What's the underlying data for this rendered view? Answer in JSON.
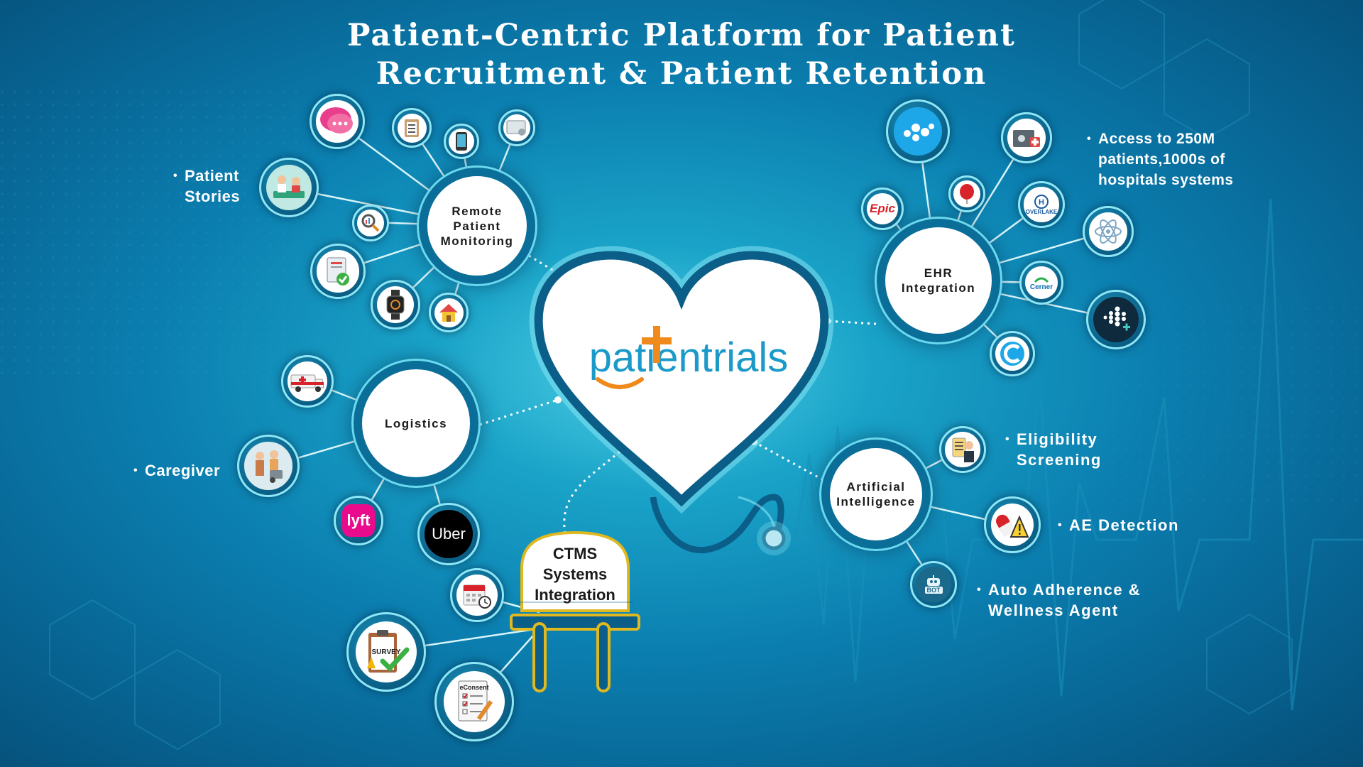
{
  "title": {
    "line1": "Patient-Centric Platform for Patient",
    "line2": "Recruitment & Patient Retention"
  },
  "center": {
    "logo_text": "patientrials",
    "logo_plus_color": "#f08a1c",
    "logo_color": "#1b9ac9"
  },
  "hubs": {
    "rpm": "Remote\nPatient\nMonitoring",
    "ehr": "EHR\nIntegration",
    "logistics": "Logistics",
    "ai": "Artificial\nIntelligence",
    "ctms": "CTMS\nSystems\nIntegration"
  },
  "bullets": {
    "patient_stories": "Patient\nStories",
    "access": "Access to 250M\npatients,1000s of\nhospitals systems",
    "caregiver": "Caregiver",
    "eligibility": "Eligibility\nScreening",
    "ae": "AE Detection",
    "adherence": "Auto Adherence &\nWellness Agent"
  },
  "logos": {
    "epic": "Epic",
    "overlake": "OVERLAKE",
    "cerner": "Cerner",
    "lyft": "lyft",
    "uber": "Uber",
    "survey": "SURVEY",
    "econsent": "eConsent",
    "bot": "BOT"
  },
  "icons": {
    "rpm_nodes": [
      "chat-bubbles-icon",
      "clipboard-checklist-icon",
      "smartphone-icon",
      "tablet-icon",
      "patient-stories-icon",
      "magnifier-chart-icon",
      "document-check-icon",
      "smartwatch-icon",
      "home-icon"
    ],
    "ehr_nodes": [
      "dots-logo-icon",
      "medical-folder-icon",
      "epic-logo-icon",
      "balloon-icon",
      "overlake-logo-icon",
      "atom-icon",
      "cerner-logo-icon",
      "fitbit-icon",
      "wave-logo-icon"
    ],
    "logistics_nodes": [
      "ambulance-icon",
      "caregiver-family-icon",
      "lyft-logo-icon",
      "uber-logo-icon"
    ],
    "ai_nodes": [
      "doctor-clipboard-icon",
      "pill-warning-icon",
      "robot-bot-icon"
    ],
    "ctms_nodes": [
      "calendar-clock-icon",
      "survey-clipboard-icon",
      "econsent-document-icon"
    ]
  },
  "colors": {
    "background_center": "#4fd0e6",
    "background_edge": "#064f78",
    "hub_ring": "#0a6e98",
    "node_ring": "#8de6f5",
    "accent_orange": "#f08a1c",
    "ctms_gold": "#e0b820"
  }
}
